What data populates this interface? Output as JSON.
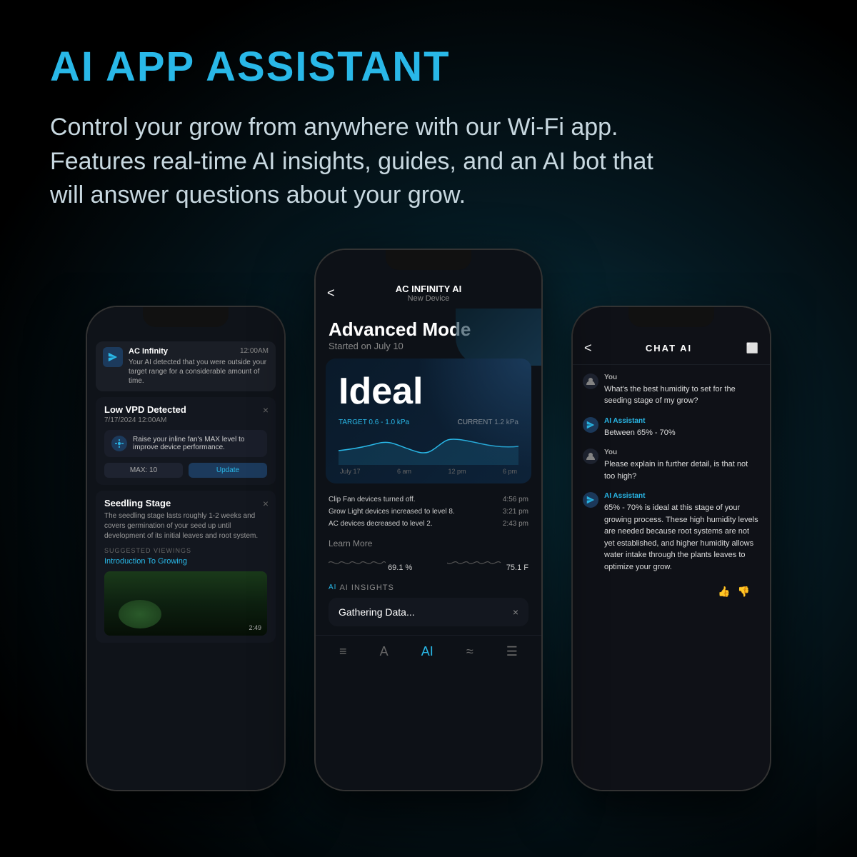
{
  "header": {
    "title": "AI APP ASSISTANT",
    "subtitle": "Control your grow from anywhere with our Wi-Fi app. Features real-time AI insights, guides, and an AI bot that will answer questions about your grow."
  },
  "left_phone": {
    "notification": {
      "brand": "AC Infinity",
      "time": "12:00AM",
      "text": "Your AI detected that you were outside your target range for a considerable amount of time."
    },
    "alert": {
      "title": "Low VPD Detected",
      "date": "7/17/2024 12:00AM",
      "action_text": "Raise your inline fan's MAX level to improve device performance.",
      "max_label": "MAX: 10",
      "update_label": "Update"
    },
    "seedling": {
      "title": "Seedling Stage",
      "text": "The seedling stage lasts roughly 1-2 weeks and covers germination of your seed up until development of its initial leaves and root system.",
      "suggested_label": "SUGGESTED VIEWINGS",
      "link": "Introduction To Growing",
      "video_time": "2:49"
    }
  },
  "center_phone": {
    "header": {
      "app_name": "AC INFINITY AI",
      "device_name": "New Device",
      "back_label": "<"
    },
    "mode": {
      "title": "Advanced Mode",
      "subtitle": "Started on July 10"
    },
    "status": {
      "word": "Ideal"
    },
    "chart": {
      "target_label": "TARGET 0.6 - 1.0 kPa",
      "current_label": "CURRENT 1.2 kPa",
      "time_labels": [
        "July 17",
        "6 am",
        "12 pm",
        "6 pm"
      ]
    },
    "events": [
      {
        "text": "Clip Fan devices turned off.",
        "time": "4:56 pm"
      },
      {
        "text": "Grow Light devices increased to level 8.",
        "time": "3:21 pm"
      },
      {
        "text": "AC devices decreased to level 2.",
        "time": "2:43 pm"
      }
    ],
    "learn_more": "Learn More",
    "humidity": {
      "left_val": "69.1 %",
      "right_val": "75.1 F"
    },
    "ai_insights": {
      "label": "AI INSIGHTS",
      "gathering_text": "Gathering Data...",
      "ai_prefix": "AI"
    },
    "bottom_nav": {
      "icons": [
        "≡",
        "A",
        "AI",
        "≈",
        "☰"
      ]
    }
  },
  "right_phone": {
    "header": {
      "title": "CHAT AI",
      "back_label": "<"
    },
    "messages": [
      {
        "sender": "You",
        "is_ai": false,
        "text": "What's the best humidity to set for the seeding stage of my grow?"
      },
      {
        "sender": "AI Assistant",
        "is_ai": true,
        "text": "Between 65% - 70%"
      },
      {
        "sender": "You",
        "is_ai": false,
        "text": "Please explain in further detail, is that not too high?"
      },
      {
        "sender": "AI Assistant",
        "is_ai": true,
        "text": "65% - 70% is ideal at this stage of your growing process. These high humidity levels are needed because root systems are not yet established, and higher humidity allows water intake through the plants leaves to optimize your grow."
      }
    ],
    "feedback": {
      "like": "👍",
      "dislike": "👎"
    }
  },
  "colors": {
    "accent": "#29b8e8",
    "bg_dark": "#0d1117",
    "text_primary": "#ffffff",
    "text_secondary": "#888888"
  }
}
